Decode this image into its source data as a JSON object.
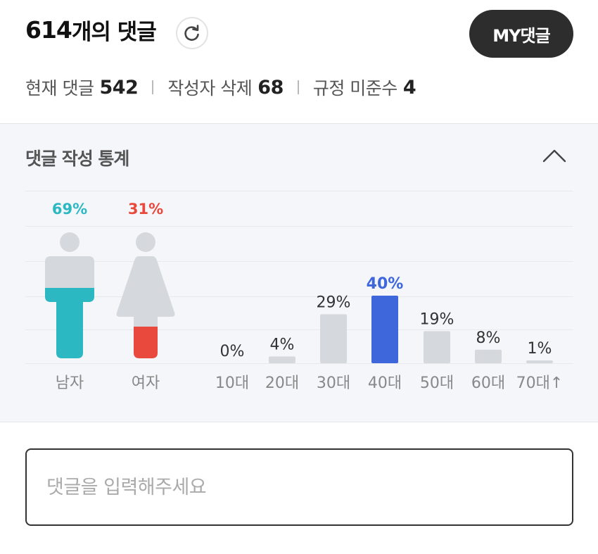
{
  "header": {
    "count_number": "614",
    "count_suffix": "개의 댓글",
    "my_button": "MY댓글"
  },
  "counts": [
    {
      "label": "현재 댓글",
      "value": "542"
    },
    {
      "label": "작성자 삭제",
      "value": "68"
    },
    {
      "label": "규정 미준수",
      "value": "4"
    }
  ],
  "stats": {
    "title": "댓글 작성 통계"
  },
  "chart_data": [
    {
      "type": "bar",
      "categories": [
        "남자",
        "여자"
      ],
      "values": [
        69,
        31
      ],
      "data_labels": [
        "69%",
        "31%"
      ],
      "colors": {
        "male": "#2bb8c3",
        "female": "#e8493c",
        "base": "#d5d9de"
      }
    },
    {
      "type": "bar",
      "categories": [
        "10대",
        "20대",
        "30대",
        "40대",
        "50대",
        "60대",
        "70대↑"
      ],
      "values": [
        0,
        4,
        29,
        40,
        19,
        8,
        1
      ],
      "data_labels": [
        "0%",
        "4%",
        "29%",
        "40%",
        "19%",
        "8%",
        "1%"
      ],
      "highlight_index": 3,
      "colors": {
        "bar": "#d5d9de",
        "highlight": "#3e67dc"
      }
    }
  ],
  "comment_input": {
    "placeholder": "댓글을 입력해주세요"
  }
}
